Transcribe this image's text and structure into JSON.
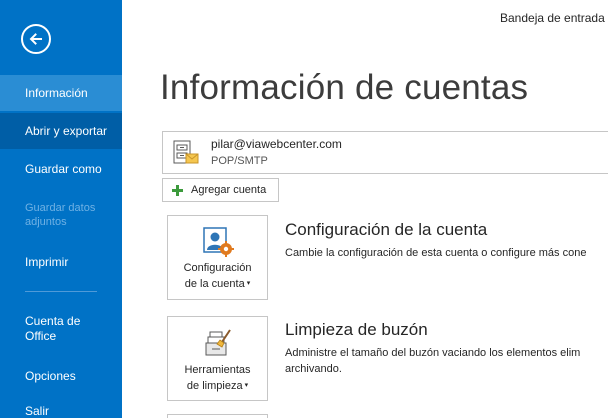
{
  "window": {
    "title": "Bandeja de entrada -"
  },
  "sidebar": {
    "back_icon": "arrow-left-circle-icon",
    "items": [
      {
        "label": "Información",
        "state": "selected"
      },
      {
        "label": "Abrir y exportar",
        "state": "hovered"
      },
      {
        "label": "Guardar como",
        "state": "normal"
      },
      {
        "label": "Guardar datos adjuntos",
        "state": "disabled"
      },
      {
        "label": "Imprimir",
        "state": "normal"
      },
      {
        "label": "Cuenta de Office",
        "state": "normal"
      },
      {
        "label": "Opciones",
        "state": "normal"
      },
      {
        "label": "Salir",
        "state": "normal"
      }
    ],
    "colors": {
      "background": "#0072c6",
      "selected": "#2a8dd4",
      "hovered": "#005ea6"
    }
  },
  "main": {
    "title": "Información de cuentas",
    "account": {
      "email": "pilar@viawebcenter.com",
      "type": "POP/SMTP",
      "icon": "mail-account-icon"
    },
    "add_account": {
      "label": "Agregar cuenta",
      "icon": "plus-icon"
    },
    "sections": [
      {
        "tile_label_line1": "Configuración",
        "tile_label_line2": "de la cuenta",
        "tile_icon": "account-settings-icon",
        "title": "Configuración de la cuenta",
        "description": "Cambie la configuración de esta cuenta o configure más cone"
      },
      {
        "tile_label_line1": "Herramientas",
        "tile_label_line2": "de limpieza",
        "tile_icon": "cleanup-tools-icon",
        "title": "Limpieza de buzón",
        "description_line1": "Administre el tamaño del buzón vaciando los elementos elim",
        "description_line2": "archivando."
      }
    ]
  }
}
